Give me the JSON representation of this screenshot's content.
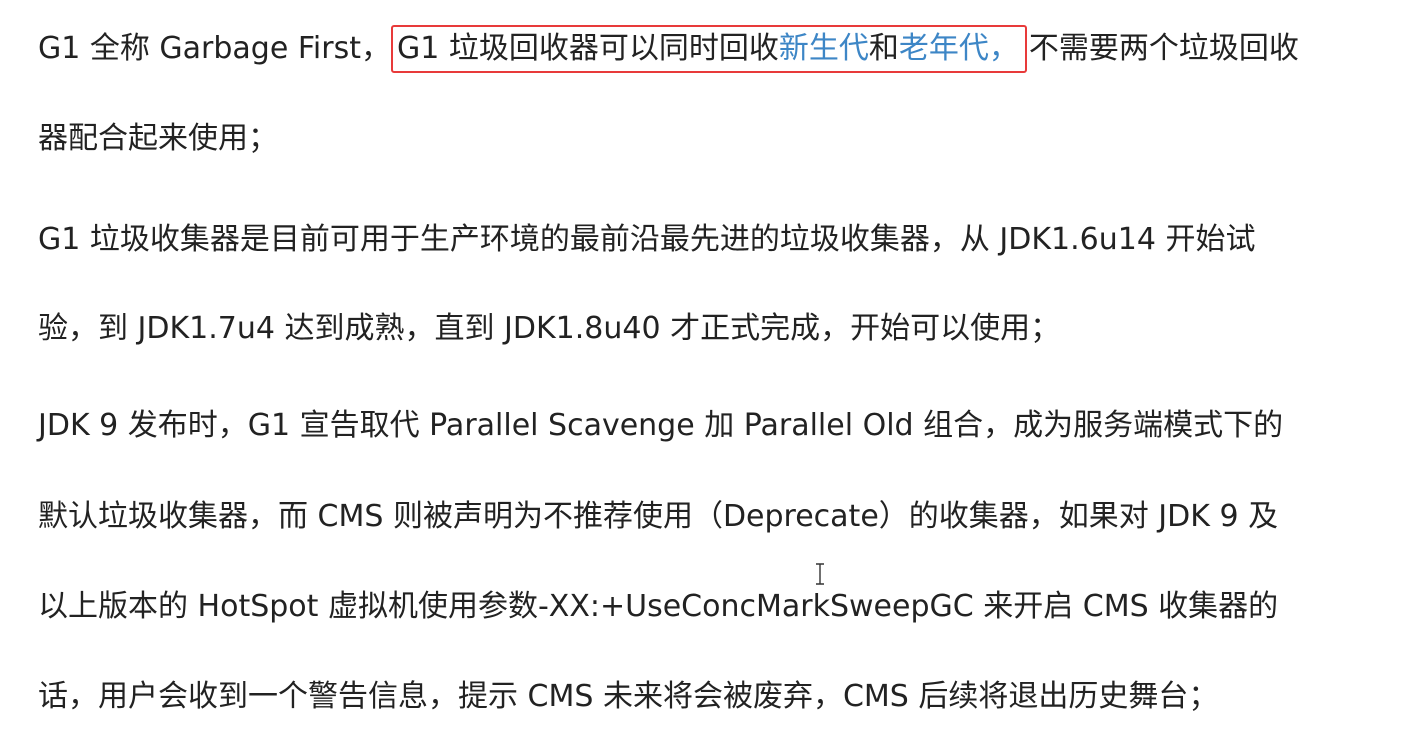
{
  "paragraphs": [
    {
      "line1": {
        "before": "G1 全称 Garbage First，",
        "highlight_start": "G1 垃圾回收器可以同时回收",
        "term_young": "新生代",
        "connector": "和",
        "term_old": "老年代",
        "highlight_end": "，",
        "after": "不需要两个垃圾回收"
      },
      "line2": "器配合起来使用；"
    },
    {
      "line1": "G1 垃圾收集器是目前可用于生产环境的最前沿最先进的垃圾收集器，从 JDK1.6u14 开始试",
      "line2": "验，到 JDK1.7u4 达到成熟，直到 JDK1.8u40 才正式完成，开始可以使用；"
    },
    {
      "line1": "JDK 9 发布时，G1 宣告取代 Parallel Scavenge 加 Parallel Old 组合，成为服务端模式下的",
      "line2": "默认垃圾收集器，而 CMS 则被声明为不推荐使用（Deprecate）的收集器，如果对 JDK 9 及",
      "line3": "以上版本的 HotSpot 虚拟机使用参数-XX:+UseConcMarkSweepGC 来开启 CMS 收集器的",
      "line4": "话，用户会收到一个警告信息，提示 CMS 未来将会被废弃，CMS 后续将退出历史舞台；"
    }
  ],
  "colors": {
    "text": "#222222",
    "highlight_border": "#e83a3a",
    "term_blue": "#3d86c6"
  },
  "cursor": {
    "icon": "text-cursor-icon"
  }
}
